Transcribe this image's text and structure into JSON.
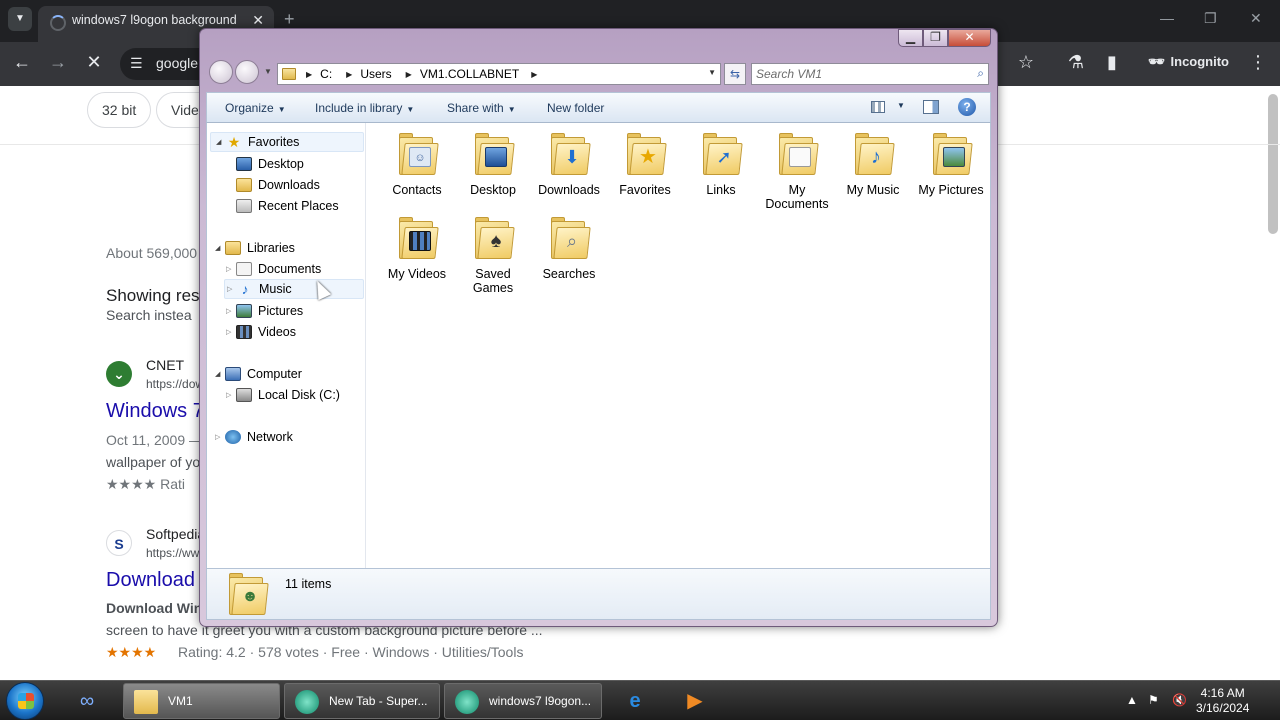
{
  "browser": {
    "tab_title": "windows7 l9ogon background",
    "tab_close": "✕",
    "new_tab": "+",
    "url_text": "google",
    "incognito_label": "Incognito",
    "chips": [
      "32 bit",
      "Video"
    ],
    "results_count": "About 569,000",
    "showing_results": "Showing res",
    "search_instead": "Search instea",
    "result1": {
      "source": "CNET",
      "url": "https://dow",
      "title": "Windows 7",
      "date": "Oct 11, 2009 —",
      "snippet": "wallpaper of you",
      "rating": "★★★★ Rati"
    },
    "result2": {
      "source": "Softpedia",
      "url": "https://www",
      "title": "Download W",
      "snippet_bold": "Download Win",
      "snippet2": "screen to have it greet you with a custom background picture before ...",
      "stars": "★★★★",
      "rating_line": "Rating: 4.2 · 578 votes · Free · Windows · Utilities/Tools"
    }
  },
  "explorer": {
    "caption": {
      "min": "▁",
      "max": "❐",
      "close": "✕"
    },
    "address": [
      "C:",
      "Users",
      "VM1.COLLABNET"
    ],
    "search_placeholder": "Search VM1",
    "commands": {
      "organize": "Organize",
      "include": "Include in library",
      "share": "Share with",
      "new_folder": "New folder"
    },
    "nav": {
      "favorites": "Favorites",
      "desktop": "Desktop",
      "downloads": "Downloads",
      "recent": "Recent Places",
      "libraries": "Libraries",
      "documents": "Documents",
      "music": "Music",
      "pictures": "Pictures",
      "videos": "Videos",
      "computer": "Computer",
      "local_disk": "Local Disk (C:)",
      "network": "Network"
    },
    "folders": [
      {
        "name": "Contacts",
        "icon": "contacts-icon"
      },
      {
        "name": "Desktop",
        "icon": "desktop-icon"
      },
      {
        "name": "Downloads",
        "icon": "downloads-icon"
      },
      {
        "name": "Favorites",
        "icon": "favorites-icon"
      },
      {
        "name": "Links",
        "icon": "links-icon"
      },
      {
        "name": "My Documents",
        "icon": "documents-icon"
      },
      {
        "name": "My Music",
        "icon": "music-icon"
      },
      {
        "name": "My Pictures",
        "icon": "pictures-icon"
      },
      {
        "name": "My Videos",
        "icon": "videos-icon"
      },
      {
        "name": "Saved Games",
        "icon": "games-icon"
      },
      {
        "name": "Searches",
        "icon": "searches-icon"
      }
    ],
    "status": "11 items"
  },
  "taskbar": {
    "tasks": [
      "VM1",
      "New Tab - Super...",
      "windows7 l9ogon..."
    ],
    "time": "4:16 AM",
    "date": "3/16/2024"
  },
  "colors": {
    "chrome_dark": "#202124",
    "link_blue": "#1a0dab",
    "aero_frame": "#cbbad4",
    "folder_yellow": "#f0cb64"
  }
}
